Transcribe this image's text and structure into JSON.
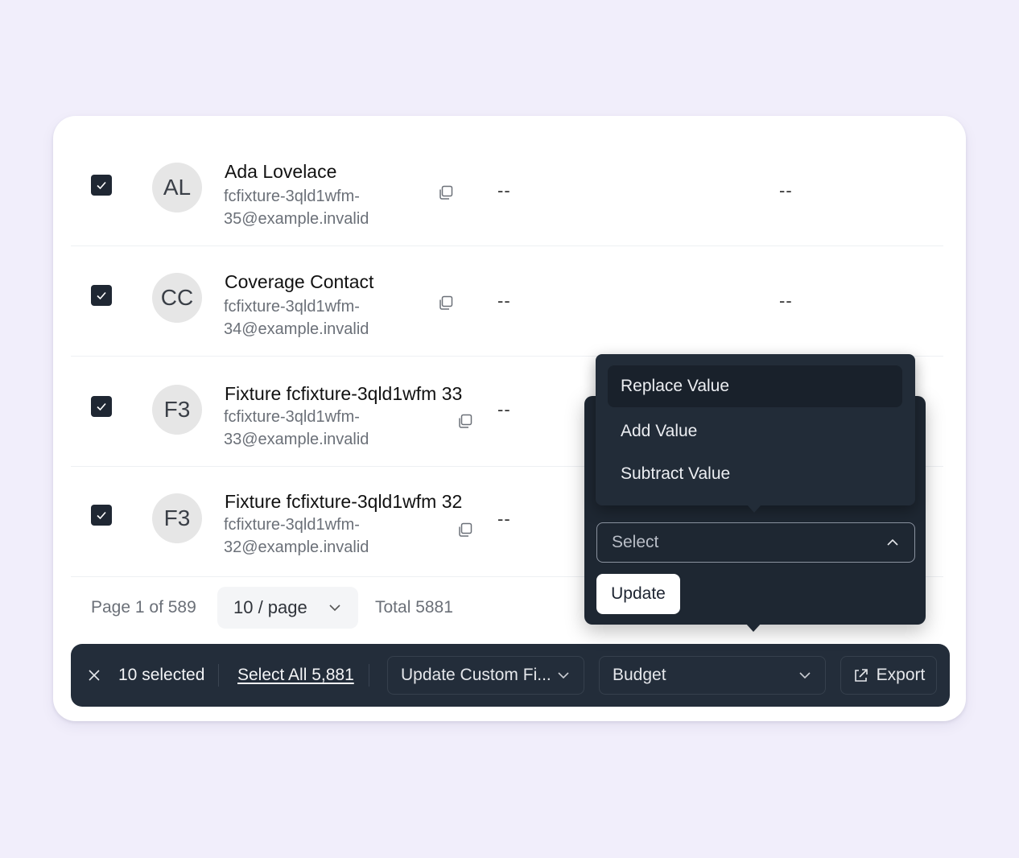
{
  "rows": [
    {
      "initials": "AL",
      "name": "Ada Lovelace",
      "email_line1": "fcfixture-3qld1wfm-",
      "email_line2": "35@example.invalid",
      "col1": "--",
      "col2": "--"
    },
    {
      "initials": "CC",
      "name": "Coverage Contact",
      "email_line1": "fcfixture-3qld1wfm-",
      "email_line2": "34@example.invalid",
      "col1": "--",
      "col2": "--"
    },
    {
      "initials": "F3",
      "name": "Fixture fcfixture-3qld1wfm 33",
      "email_line1": "fcfixture-3qld1wfm-",
      "email_line2": "33@example.invalid",
      "col1": "--"
    },
    {
      "initials": "F3",
      "name": "Fixture fcfixture-3qld1wfm 32",
      "email_line1": "fcfixture-3qld1wfm-",
      "email_line2": "32@example.invalid",
      "col1": "--"
    }
  ],
  "pagination": {
    "page_text": "Page 1 of 589",
    "page_size": "10 / page",
    "total_text": "Total 5881"
  },
  "bulk_bar": {
    "selected_count": "10 selected",
    "select_all": "Select All 5,881",
    "field_dropdown": "Update Custom Fi...",
    "field_value": "Budget",
    "export_label": "Export"
  },
  "popover": {
    "operation_menu": [
      "Replace Value",
      "Add Value",
      "Subtract Value"
    ],
    "active_operation": "Replace Value",
    "select_placeholder": "Select",
    "update_label": "Update"
  },
  "colors": {
    "page_bg": "#f1eefb",
    "dark_surface": "#232d3a",
    "checkbox": "#1f2733"
  }
}
